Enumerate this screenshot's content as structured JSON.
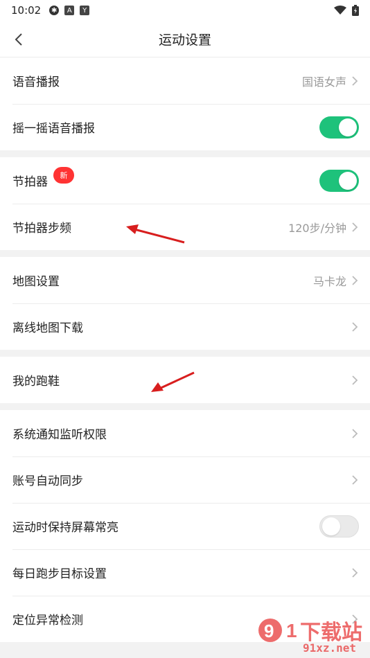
{
  "statusbar": {
    "time": "10:02"
  },
  "header": {
    "title": "运动设置"
  },
  "groups": [
    {
      "items": [
        {
          "label": "语音播报",
          "value": "国语女声"
        },
        {
          "label": "摇一摇语音播报"
        }
      ]
    },
    {
      "items": [
        {
          "label": "节拍器",
          "badge": "新"
        },
        {
          "label": "节拍器步频",
          "value": "120步/分钟"
        }
      ]
    },
    {
      "items": [
        {
          "label": "地图设置",
          "value": "马卡龙"
        },
        {
          "label": "离线地图下载"
        }
      ]
    },
    {
      "items": [
        {
          "label": "我的跑鞋"
        }
      ]
    },
    {
      "items": [
        {
          "label": "系统通知监听权限"
        },
        {
          "label": "账号自动同步"
        },
        {
          "label": "运动时保持屏幕常亮"
        },
        {
          "label": "每日跑步目标设置"
        },
        {
          "label": "定位异常检测"
        }
      ]
    }
  ],
  "watermark": {
    "site": "91xz.net",
    "text": "下载站"
  },
  "colors": {
    "accent": "#1ec27b",
    "badge": "#ff3333",
    "annotation": "#d81e1e"
  }
}
